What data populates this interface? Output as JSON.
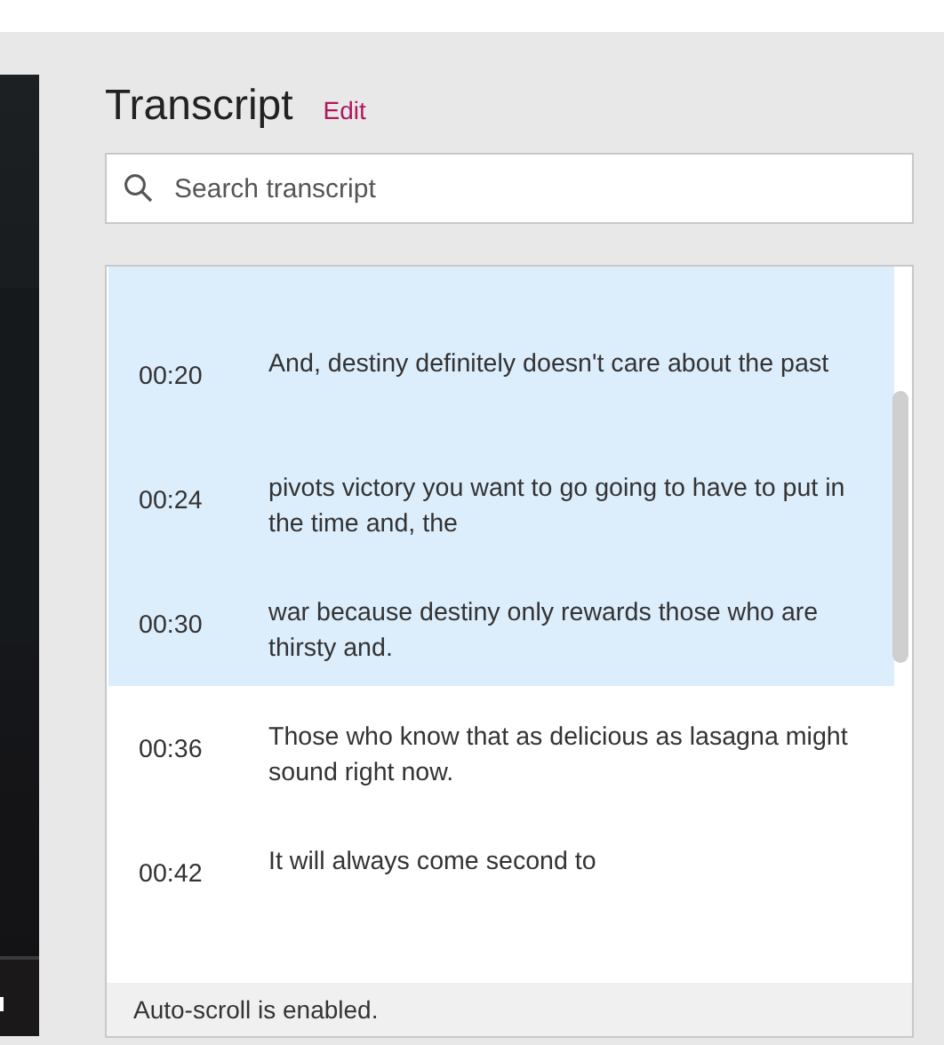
{
  "transcript": {
    "title": "Transcript",
    "edit_link": "Edit"
  },
  "search": {
    "placeholder": "Search transcript"
  },
  "entries": [
    {
      "time": "00:20",
      "text": "And, destiny definitely doesn't care about the past",
      "selected": true
    },
    {
      "time": "00:24",
      "text": "pivots victory you want to go going to have to put in the time and, the",
      "selected": true
    },
    {
      "time": "00:30",
      "text": "war because destiny only rewards those who are thirsty and.",
      "selected": true
    },
    {
      "time": "00:36",
      "text": "Those who know that as delicious as lasagna might sound right now.",
      "selected": false
    },
    {
      "time": "00:42",
      "text": "It will always come second to",
      "selected": false
    }
  ],
  "status": "Auto-scroll is enabled."
}
